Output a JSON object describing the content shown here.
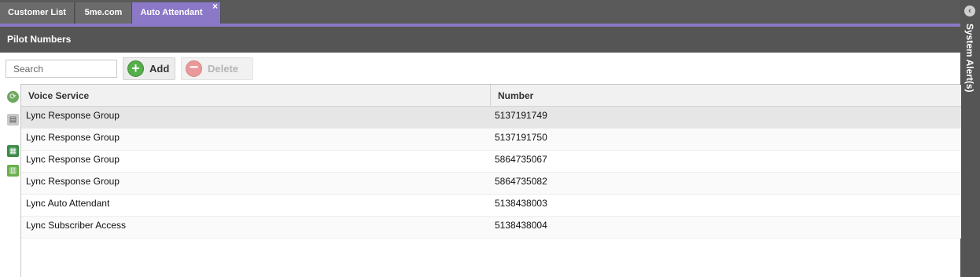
{
  "tabs": [
    {
      "label": "Customer List"
    },
    {
      "label": "5me.com"
    },
    {
      "label": "Auto Attendant",
      "close": "×"
    }
  ],
  "section": {
    "title": "Pilot Numbers"
  },
  "alerts": {
    "label": "System Alert(s)"
  },
  "toolbar": {
    "search_placeholder": "Search",
    "add_label": "Add",
    "delete_label": "Delete"
  },
  "grid": {
    "columns": [
      "Voice Service",
      "Number"
    ],
    "rows": [
      {
        "service": "Lync Response Group",
        "number": "5137191749"
      },
      {
        "service": "Lync Response Group",
        "number": "5137191750"
      },
      {
        "service": "Lync Response Group",
        "number": "5864735067"
      },
      {
        "service": "Lync Response Group",
        "number": "5864735082"
      },
      {
        "service": "Lync Auto Attendant",
        "number": "5138438003"
      },
      {
        "service": "Lync Subscriber Access",
        "number": "5138438004"
      }
    ]
  },
  "icons": {
    "refresh": "refresh-icon",
    "print": "print-icon",
    "excel": "excel-export-icon",
    "csv": "csv-export-icon"
  },
  "colors": {
    "accent": "#8b78c6",
    "header_bg": "#555555",
    "add_green": "#55b04a"
  }
}
